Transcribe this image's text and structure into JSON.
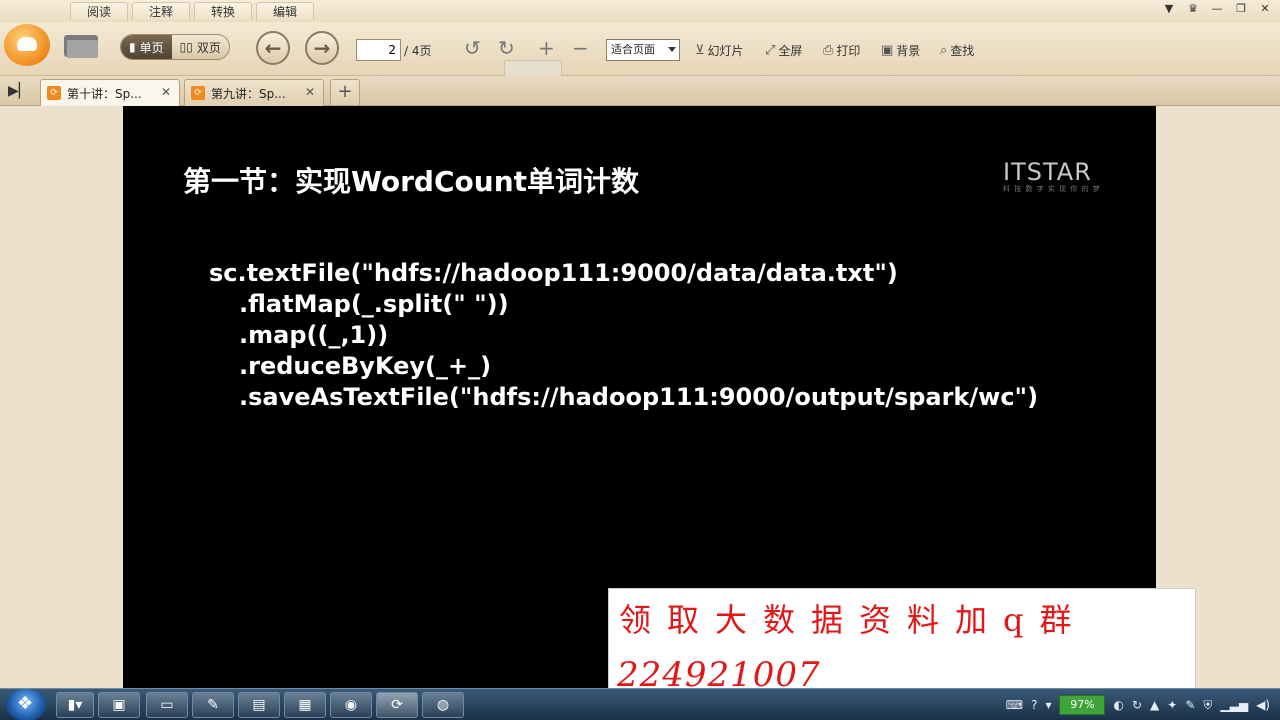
{
  "menu": {
    "tabs": [
      "阅读",
      "注释",
      "转换",
      "编辑"
    ]
  },
  "toolbar": {
    "single_page": "单页",
    "double_page": "双页",
    "page_current": "2",
    "page_total": "/ 4页",
    "zoom_mode": "适合页面",
    "slideshow": "幻灯片",
    "fullscreen": "全屏",
    "print": "打印",
    "background": "背景",
    "find": "查找"
  },
  "tabs": [
    {
      "label": "第十讲：Sp..."
    },
    {
      "label": "第九讲：Sp..."
    }
  ],
  "slide": {
    "title": "第一节：实现WordCount单词计数",
    "brand": "ITSTAR",
    "brand_tagline": "科 技 数 字 实 现 你 的 梦",
    "code_lines": [
      "sc.textFile(\"hdfs://hadoop111:9000/data/data.txt\")",
      ".flatMap(_.split(\" \"))",
      ".map((_,1))",
      ".reduceByKey(_+_)",
      ".saveAsTextFile(\"hdfs://hadoop111:9000/output/spark/wc\")"
    ]
  },
  "promo": {
    "line1": "领取大数据资料加q群",
    "line2": "224921007"
  },
  "taskbar": {
    "battery": "97%"
  }
}
